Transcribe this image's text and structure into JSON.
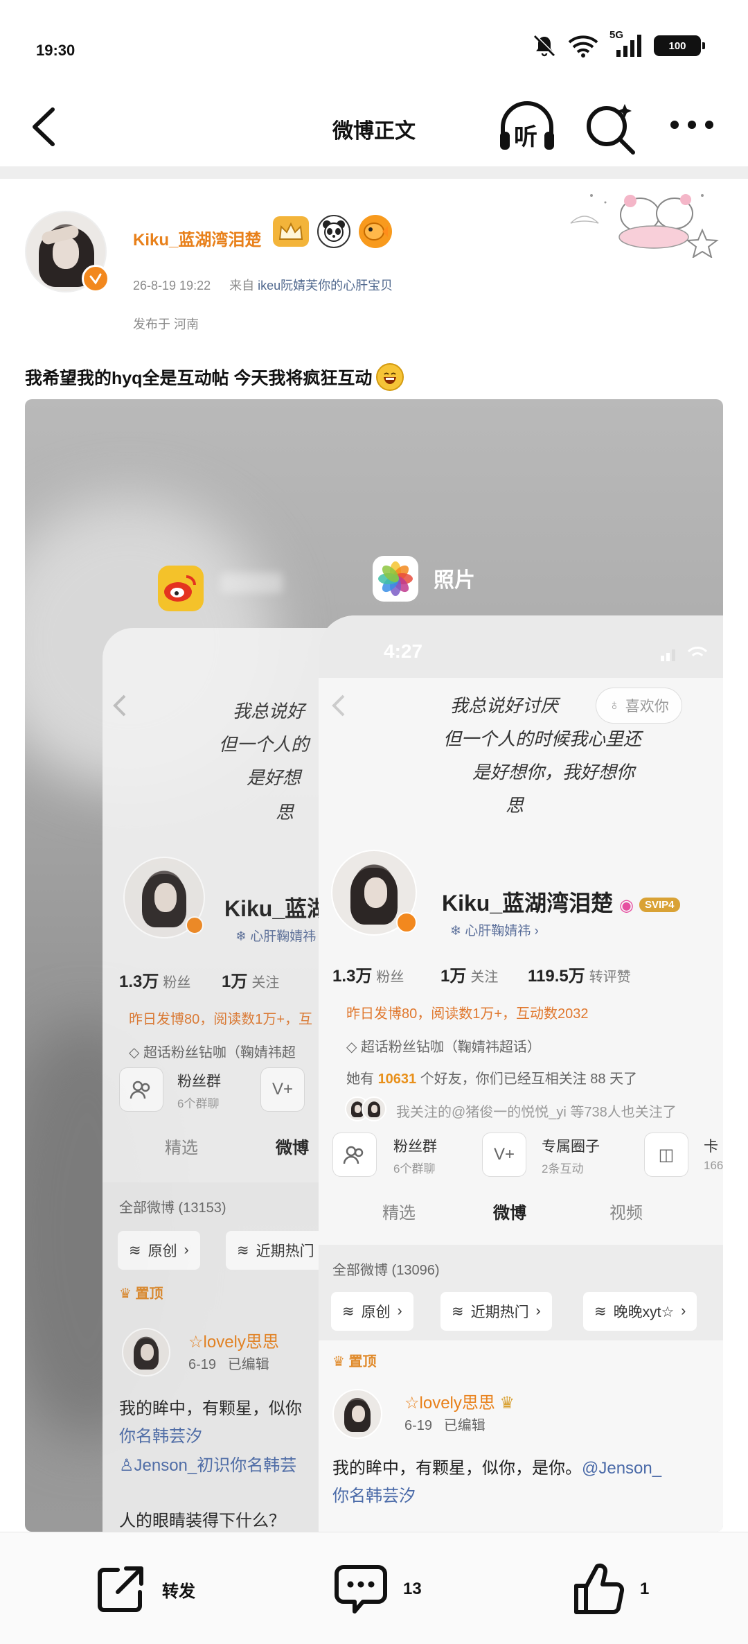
{
  "status_bar": {
    "time": "19:30",
    "network": "5G",
    "battery": "100"
  },
  "nav": {
    "title": "微博正文",
    "listen_label": "听"
  },
  "post": {
    "username": "Kiku_蓝湖湾泪楚",
    "timestamp": "26-8-19 19:22",
    "source_prefix": "来自",
    "source": "ikeu阮婧芙你的心肝宝贝",
    "location": "发布于 河南",
    "text": "我希望我的hyq全是互动帖 今天我将疯狂互动"
  },
  "screenshot": {
    "app_label": "照片",
    "front": {
      "time": "4:27",
      "hand_lines": [
        "我总说好讨厌",
        "但一个人的时候我心里还",
        "是好想你，我好想你",
        "思"
      ],
      "like_label": "喜欢你",
      "name": "Kiku_蓝湖湾泪楚",
      "svip": "SVIP4",
      "sub": "心肝鞠婧祎",
      "stats": [
        {
          "value": "1.3万",
          "label": "粉丝"
        },
        {
          "value": "1万",
          "label": "关注"
        },
        {
          "value": "119.5万",
          "label": "转评赞"
        }
      ],
      "activity": "昨日发博80，阅读数1万+，互动数2032",
      "super_topic": "超话粉丝钻咖（鞠婧祎超话）",
      "friends_prefix": "她有",
      "friends_count": "10631",
      "friends_suffix": "个好友，你们已经互相关注 88 天了",
      "mutual": "我关注的@猪俊一的悦悦_yi 等738人也关注了",
      "rows": [
        {
          "title": "粉丝群",
          "sub": "6个群聊"
        },
        {
          "title": "专属圈子",
          "sub": "2条互动"
        },
        {
          "title": "卡",
          "sub": "166"
        }
      ],
      "tabs": [
        "精选",
        "微博",
        "视频"
      ],
      "all_posts": "全部微博 (13096)",
      "chips": [
        "原创",
        "近期热门",
        "晚晚xyt☆"
      ],
      "pinned": "置顶",
      "post_user": "☆lovely思思",
      "post_time": "6-19",
      "post_edited": "已编辑",
      "post_body": "我的眸中，有颗星，似你，是你。",
      "post_link": "@Jenson_",
      "post_body2": "你名韩芸汐"
    },
    "back": {
      "hand_lines": [
        "我总说好",
        "但一个人的",
        "是好想",
        "思"
      ],
      "name": "Kiku_蓝湖",
      "sub": "心肝鞠婧祎",
      "stats": [
        {
          "value": "1.3万",
          "label": "粉丝"
        },
        {
          "value": "1万",
          "label": "关注"
        }
      ],
      "activity": "昨日发博80，阅读数1万+，互",
      "super_topic": "超话粉丝钻咖（鞠婧祎超",
      "row_title": "粉丝群",
      "row_sub": "6个群聊",
      "tabs": [
        "精选",
        "微博"
      ],
      "all_posts": "全部微博 (13153)",
      "chips": [
        "原创",
        "近期热门"
      ],
      "pinned": "置顶",
      "post_user": "☆lovely思思",
      "post_time": "6-19",
      "post_edited": "已编辑",
      "post_body": "我的眸中，有颗星，似你",
      "post_body2": "你名韩芸汐",
      "post_mention": "Jenson_初识你名韩芸",
      "post_body3": "人的眼睛装得下什么？"
    }
  },
  "actions": {
    "repost_label": "转发",
    "comment_count": "13",
    "like_count": "1"
  },
  "colors": {
    "accent": "#e8801a",
    "link": "#50688e"
  }
}
